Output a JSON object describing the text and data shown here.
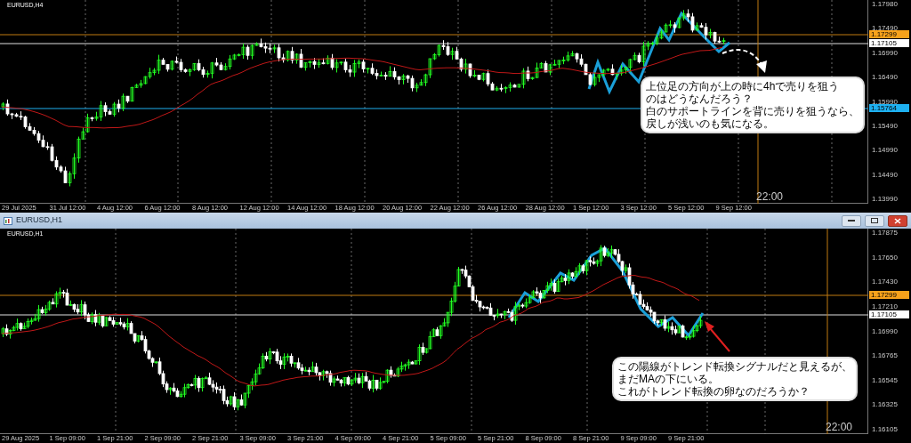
{
  "top_chart": {
    "title": "EURUSD,H4",
    "price_axis": [
      "1.17980",
      "1.17490",
      "1.16990",
      "1.16490",
      "1.15990",
      "1.15490",
      "1.14990",
      "1.14490",
      "1.13990"
    ],
    "price_tags": [
      {
        "text": "1.17299",
        "color": "#f7a21b"
      },
      {
        "text": "1.17105",
        "color": "#ffffff"
      },
      {
        "text": "1.15764",
        "color": "#1eb0f0"
      }
    ],
    "time_axis": [
      "29 Jul 2025",
      "31 Jul 12:00",
      "4 Aug 12:00",
      "6 Aug 12:00",
      "8 Aug 12:00",
      "12 Aug 12:00",
      "14 Aug 12:00",
      "18 Aug 12:00",
      "20 Aug 12:00",
      "22 Aug 12:00",
      "26 Aug 12:00",
      "28 Aug 12:00",
      "1 Sep 12:00",
      "3 Sep 12:00",
      "5 Sep 12:00",
      "9 Sep 12:00"
    ],
    "time_marker": "22:00",
    "note": [
      "上位足の方向が上の時に4hで売りを狙う",
      "のはどうなんだろう？",
      "白のサポートラインを背に売りを狙うなら、",
      "戻しが浅いのも気になる。"
    ]
  },
  "window": {
    "title": "EURUSD,H1"
  },
  "bottom_chart": {
    "title": "EURUSD,H1",
    "price_axis": [
      "1.17875",
      "1.17650",
      "1.17430",
      "1.17210",
      "1.16990",
      "1.16765",
      "1.16545",
      "1.16325",
      "1.16105"
    ],
    "price_tags": [
      {
        "text": "1.17299",
        "color": "#f7a21b"
      },
      {
        "text": "1.17105",
        "color": "#ffffff"
      }
    ],
    "time_axis": [
      "29 Aug 2025",
      "1 Sep 09:00",
      "1 Sep 21:00",
      "2 Sep 09:00",
      "2 Sep 21:00",
      "3 Sep 09:00",
      "3 Sep 21:00",
      "4 Sep 09:00",
      "4 Sep 21:00",
      "5 Sep 09:00",
      "5 Sep 21:00",
      "8 Sep 09:00",
      "8 Sep 21:00",
      "9 Sep 09:00",
      "9 Sep 21:00"
    ],
    "time_marker": "22:00",
    "note": [
      "この陽線がトレンド転換シグナルだと見えるが、",
      "まだMAの下にいる。",
      "これがトレンド転換の卵なのだろうか？"
    ]
  }
}
